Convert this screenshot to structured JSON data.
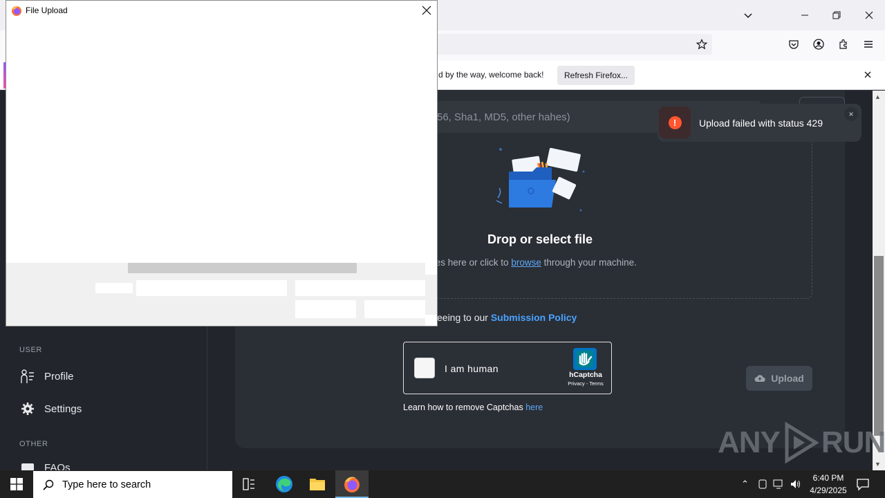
{
  "browser": {
    "notification_text": "d by the way, welcome back!",
    "refresh_button": "Refresh Firefox..."
  },
  "page": {
    "search_placeholder": "56, Sha1, MD5, other hahes)",
    "drop_title": "Drop or select file",
    "drop_sub_prefix": "files here or click to",
    "drop_sub_link": "browse",
    "drop_sub_suffix": "through your machine.",
    "policy_prefix": "eeing to our",
    "policy_link": "Submission Policy",
    "captcha_label": "I am human",
    "hcaptcha_name": "hCaptcha",
    "hcaptcha_links": "Privacy - Terms",
    "learn_prefix": "Learn how to remove Captchas",
    "learn_link": "here",
    "upload_button": "Upload"
  },
  "sidebar": {
    "user_heading": "USER",
    "profile": "Profile",
    "settings": "Settings",
    "other_heading": "OTHER",
    "faqs": "FAQs"
  },
  "toast": {
    "message": "Upload failed with status 429"
  },
  "dialog": {
    "title": "File Upload"
  },
  "watermark": {
    "left": "ANY",
    "right": "RUN"
  },
  "taskbar": {
    "search_placeholder": "Type here to search",
    "time": "6:40 PM",
    "date": "4/29/2025"
  },
  "icons": {
    "firefox": "firefox-icon",
    "windows": "windows-start-icon"
  },
  "colors": {
    "accent_link": "#4aa3ff",
    "error": "#ff5630",
    "page_bg": "#22262c"
  }
}
